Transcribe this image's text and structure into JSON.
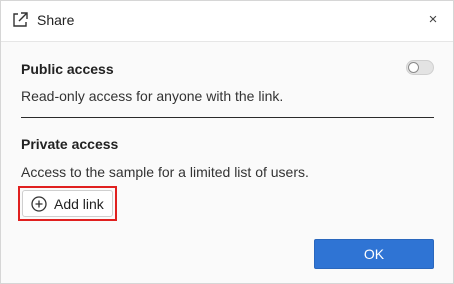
{
  "dialog": {
    "title": "Share",
    "close_glyph": "×",
    "icons": {
      "title_icon": "share-external-icon",
      "close_icon": "close-icon",
      "add_icon": "plus-circle-icon"
    }
  },
  "public_access": {
    "title": "Public access",
    "description": "Read-only access for anyone with the link.",
    "toggle_on": false
  },
  "private_access": {
    "title": "Private access",
    "description": "Access to the sample for a limited list of users.",
    "add_link_label": "Add link"
  },
  "footer": {
    "ok_label": "OK"
  },
  "colors": {
    "accent": "#2f74d4",
    "highlight": "#e0201f"
  }
}
